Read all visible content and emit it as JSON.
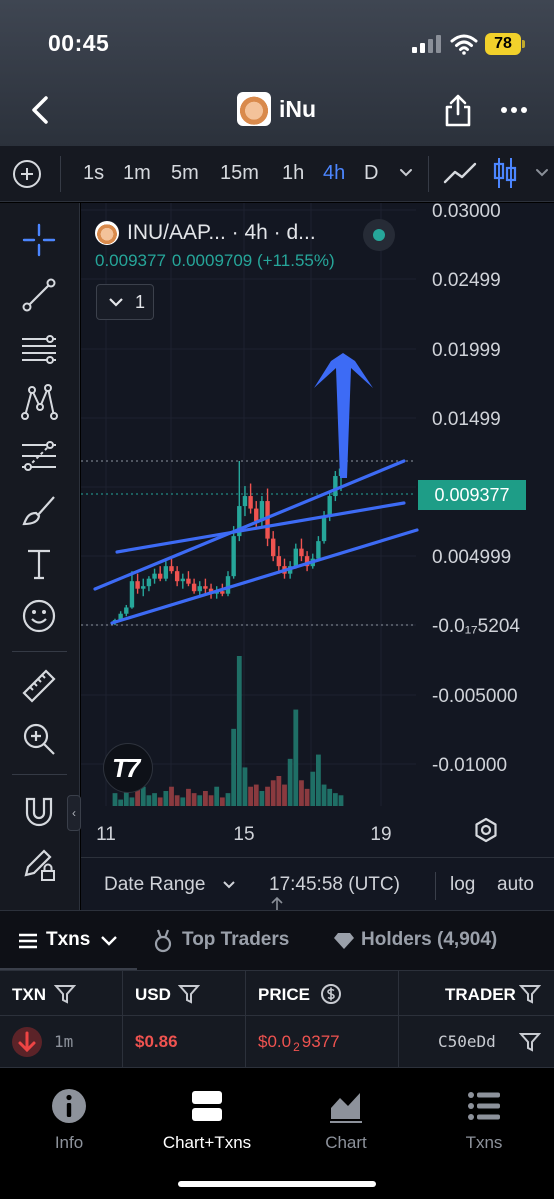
{
  "status_bar": {
    "time": "00:45",
    "battery": "78"
  },
  "header": {
    "title": "iNu"
  },
  "timeframes": [
    {
      "label": "1s",
      "active": false
    },
    {
      "label": "1m",
      "active": false
    },
    {
      "label": "5m",
      "active": false
    },
    {
      "label": "15m",
      "active": false
    },
    {
      "label": "1h",
      "active": false
    },
    {
      "label": "4h",
      "active": true
    },
    {
      "label": "D",
      "active": false
    }
  ],
  "legend": {
    "title": "INU/AAP... · 4h · d...",
    "price": "0.009377",
    "change": "0.0009709 (+11.55%)",
    "collapsed_count": "1"
  },
  "chart_data": {
    "type": "candlestick",
    "y_ticks": [
      "0.03000",
      "0.02499",
      "0.01999",
      "0.01499",
      "0.004999",
      "-0.0₁₇5204",
      "-0.005000",
      "-0.01000"
    ],
    "x_ticks": [
      "11",
      "15",
      "19"
    ],
    "last_price": "0.009377",
    "colors": {
      "up": "#26a69a",
      "down": "#ef5350",
      "drawings": "#3d6bf5"
    },
    "ohlc_pixels_note": "",
    "candles": [
      [
        1.2,
        1.3,
        1.05,
        1.25
      ],
      [
        1.25,
        1.6,
        1.2,
        1.5
      ],
      [
        1.5,
        1.85,
        1.4,
        1.75
      ],
      [
        1.75,
        3.2,
        1.7,
        2.8
      ],
      [
        2.8,
        3.1,
        2.3,
        2.5
      ],
      [
        2.5,
        2.9,
        2.2,
        2.6
      ],
      [
        2.6,
        3.0,
        2.4,
        2.9
      ],
      [
        2.9,
        3.3,
        2.7,
        3.1
      ],
      [
        3.1,
        3.4,
        2.8,
        2.9
      ],
      [
        2.9,
        3.6,
        2.8,
        3.4
      ],
      [
        3.4,
        3.7,
        3.1,
        3.2
      ],
      [
        3.2,
        3.4,
        2.6,
        2.8
      ],
      [
        2.8,
        3.1,
        2.5,
        2.9
      ],
      [
        2.9,
        3.2,
        2.6,
        2.7
      ],
      [
        2.7,
        2.9,
        2.3,
        2.4
      ],
      [
        2.4,
        2.8,
        2.2,
        2.6
      ],
      [
        2.6,
        2.9,
        2.3,
        2.5
      ],
      [
        2.5,
        2.7,
        2.1,
        2.3
      ],
      [
        2.3,
        2.6,
        2.1,
        2.4
      ],
      [
        2.4,
        2.7,
        2.2,
        2.3
      ],
      [
        2.3,
        3.2,
        2.2,
        3.0
      ],
      [
        3.0,
        5.0,
        2.9,
        4.6
      ],
      [
        4.6,
        7.6,
        4.4,
        5.8
      ],
      [
        5.8,
        6.6,
        5.4,
        6.2
      ],
      [
        6.2,
        6.7,
        5.5,
        5.7
      ],
      [
        5.7,
        6.0,
        4.9,
        5.2
      ],
      [
        5.2,
        6.2,
        5.0,
        6.0
      ],
      [
        6.0,
        6.5,
        4.2,
        4.5
      ],
      [
        4.5,
        4.8,
        3.6,
        3.8
      ],
      [
        3.8,
        4.2,
        3.1,
        3.4
      ],
      [
        3.4,
        3.7,
        2.9,
        3.1
      ],
      [
        3.1,
        3.6,
        2.9,
        3.4
      ],
      [
        3.4,
        4.3,
        3.3,
        4.1
      ],
      [
        4.1,
        4.5,
        3.6,
        3.8
      ],
      [
        3.8,
        4.0,
        3.2,
        3.4
      ],
      [
        3.4,
        3.9,
        3.3,
        3.7
      ],
      [
        3.7,
        4.6,
        3.6,
        4.4
      ],
      [
        4.4,
        5.6,
        4.3,
        5.4
      ],
      [
        5.4,
        6.4,
        5.2,
        6.2
      ],
      [
        6.2,
        7.2,
        6.0,
        7.0
      ],
      [
        7.0,
        7.5,
        6.4,
        7.3
      ]
    ],
    "volumes": [
      6,
      3,
      8,
      4,
      28,
      9,
      5,
      6,
      4,
      7,
      9,
      5,
      4,
      8,
      6,
      5,
      7,
      5,
      9,
      4,
      6,
      36,
      70,
      18,
      9,
      10,
      7,
      9,
      12,
      14,
      10,
      22,
      45,
      12,
      8,
      16,
      24,
      10,
      8,
      6,
      5
    ]
  },
  "range_bar": {
    "date_range": "Date Range",
    "time": "17:45:58 (UTC)",
    "log": "log",
    "auto": "auto"
  },
  "tabs": [
    {
      "label": "Txns",
      "active": true
    },
    {
      "label": "Top Traders",
      "active": false
    },
    {
      "label": "Holders (4,904)",
      "active": false
    }
  ],
  "table": {
    "headers": {
      "txn": "TXN",
      "usd": "USD",
      "price": "PRICE",
      "trader": "TRADER"
    },
    "rows": [
      {
        "age": "1m",
        "usd": "$0.86",
        "price_prefix": "$0.0",
        "price_sub": "2",
        "price_rest": "9377",
        "trader": "C50eDd"
      }
    ]
  },
  "bottom_nav": [
    {
      "label": "Info",
      "active": false
    },
    {
      "label": "Chart+Txns",
      "active": true
    },
    {
      "label": "Chart",
      "active": false
    },
    {
      "label": "Txns",
      "active": false
    }
  ]
}
